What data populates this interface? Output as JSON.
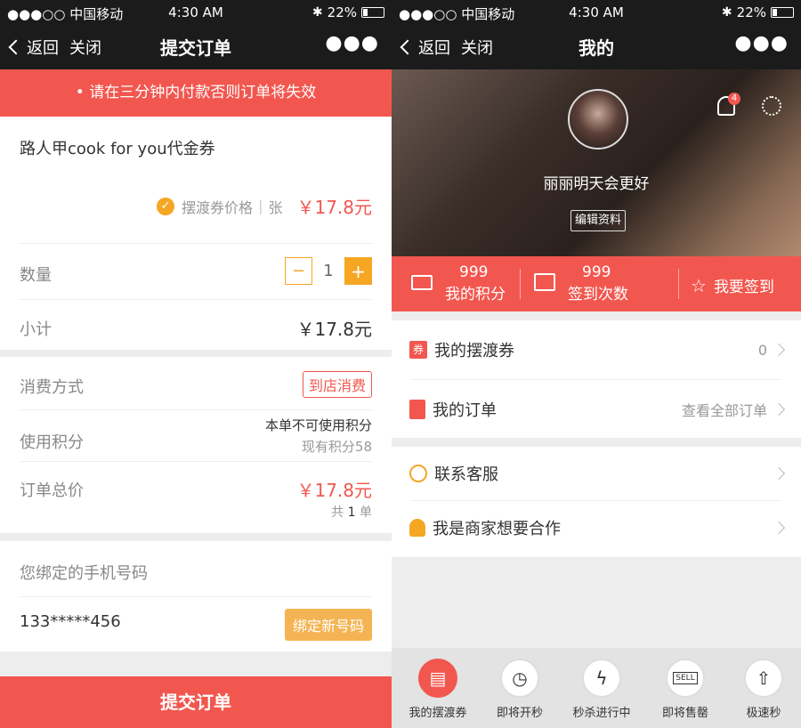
{
  "status_bar": {
    "carrier": "●●●○○ 中国移动",
    "time": "4:30  AM",
    "battery": "22%"
  },
  "left": {
    "nav": {
      "back": "返回",
      "close": "关闭",
      "title": "提交订单"
    },
    "warning": "请在三分钟内付款否则订单将失效",
    "product": {
      "name": "路人甲cook for you代金券",
      "price_label": "摆渡券价格",
      "unit": "张",
      "price": "￥17.8元"
    },
    "quantity": {
      "label": "数量",
      "value": "1",
      "minus": "−",
      "plus": "+"
    },
    "subtotal": {
      "label": "小计",
      "value": "￥17.8元"
    },
    "consume": {
      "label": "消费方式",
      "value": "到店消费"
    },
    "points": {
      "label": "使用积分",
      "note": "本单不可使用积分",
      "current": "现有积分58"
    },
    "total": {
      "label": "订单总价",
      "value": "￥17.8元",
      "count_prefix": "共",
      "count": "1",
      "count_suffix": "单"
    },
    "phone": {
      "label": "您绑定的手机号码",
      "number": "133*****456",
      "button": "绑定新号码"
    },
    "submit": "提交订单"
  },
  "right": {
    "nav": {
      "back": "返回",
      "close": "关闭",
      "title": "我的"
    },
    "profile": {
      "name": "丽丽明天会更好",
      "edit": "编辑资料",
      "notification_count": "4"
    },
    "stats": [
      {
        "value": "999",
        "label": "我的积分",
        "icon": "ticket-icon"
      },
      {
        "value": "999",
        "label": "签到次数",
        "icon": "calendar-icon"
      },
      {
        "label": "我要签到",
        "icon": "star-icon"
      }
    ],
    "menu": [
      {
        "label": "我的摆渡券",
        "right": "0",
        "icon": "voucher-icon",
        "icon_text": "券"
      },
      {
        "label": "我的订单",
        "right": "查看全部订单",
        "icon": "order-icon"
      },
      {
        "label": "联系客服",
        "right": "",
        "icon": "headset-icon"
      },
      {
        "label": "我是商家想要合作",
        "right": "",
        "icon": "merchant-icon"
      }
    ],
    "tabs": [
      {
        "label": "我的摆渡券",
        "icon": "voucher-tab-icon"
      },
      {
        "label": "即将开秒",
        "icon": "timer-icon"
      },
      {
        "label": "秒杀进行中",
        "icon": "lightning-icon"
      },
      {
        "label": "即将售罄",
        "icon": "sell-sign-icon",
        "sign": "SELL"
      },
      {
        "label": "极速秒",
        "icon": "rocket-icon"
      }
    ]
  },
  "colors": {
    "accent": "#f2574f",
    "orange": "#f5a623",
    "dark": "#1b1b1b"
  }
}
